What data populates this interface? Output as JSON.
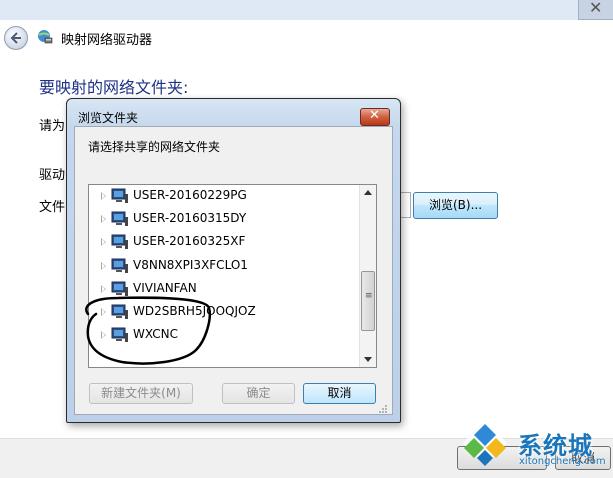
{
  "window": {
    "title": "映射网络驱动器",
    "heading": "要映射的网络文件夹:",
    "partial_labels": [
      "请为",
      "驱动",
      "文件"
    ],
    "browse_label": "浏览(B)...",
    "cancel_label": "取消"
  },
  "dialog": {
    "title": "浏览文件夹",
    "prompt": "请选择共享的网络文件夹",
    "tree_items": [
      {
        "label": "USER-20160229PG"
      },
      {
        "label": "USER-20160315DY"
      },
      {
        "label": "USER-20160325XF"
      },
      {
        "label": "V8NN8XPI3XFCLO1"
      },
      {
        "label": "VIVIANFAN"
      },
      {
        "label": "WD2SBRH5JOOQJOZ"
      },
      {
        "label": "WXCNC"
      }
    ],
    "new_folder_label": "新建文件夹(M)",
    "ok_label": "确定",
    "cancel_label": "取消"
  },
  "watermark": {
    "brand": "系统城",
    "url": "xitongcheng.com"
  },
  "colors": {
    "heading": "#1e3287",
    "annotation": "#000000",
    "watermark": "#1b75bb"
  }
}
